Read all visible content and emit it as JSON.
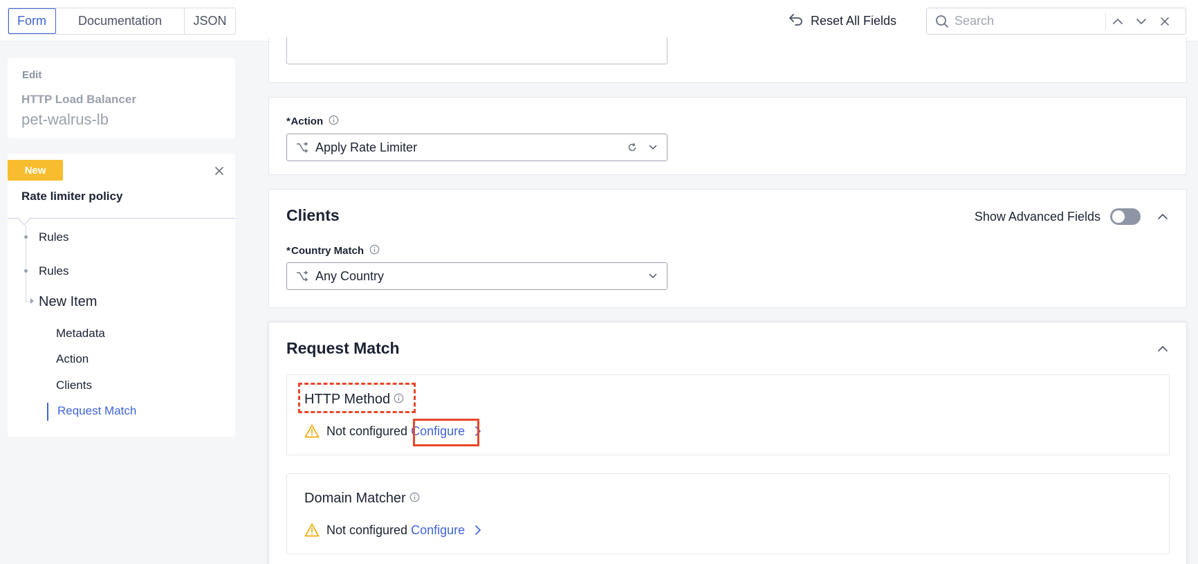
{
  "toolbar": {
    "tabs": [
      "Form",
      "Documentation",
      "JSON"
    ],
    "active_tab": "Form",
    "reset_label": "Reset All Fields",
    "search_placeholder": "Search",
    "search_value": ""
  },
  "sidebar": {
    "edit_label": "Edit",
    "object_kind": "HTTP Load Balancer",
    "object_name": "pet-walrus-lb",
    "badge": "New",
    "nav_title": "Rate limiter policy",
    "tree": [
      {
        "label": "Rules"
      },
      {
        "label": "Rules"
      },
      {
        "label": "New Item"
      }
    ],
    "sections": [
      {
        "label": "Metadata"
      },
      {
        "label": "Action"
      },
      {
        "label": "Clients"
      },
      {
        "label": "Request Match",
        "active": true
      }
    ]
  },
  "main": {
    "action": {
      "label": "Action",
      "required_mark": "*",
      "value": "Apply Rate Limiter"
    },
    "clients": {
      "title": "Clients",
      "advanced_label": "Show Advanced Fields",
      "advanced_on": false,
      "country_label": "Country Match",
      "required_mark": "*",
      "country_value": "Any Country"
    },
    "request_match": {
      "title": "Request Match",
      "items": [
        {
          "title": "HTTP Method",
          "status": "Not configured",
          "action": "Configure"
        },
        {
          "title": "Domain Matcher",
          "status": "Not configured",
          "action": "Configure"
        }
      ]
    }
  },
  "colors": {
    "accent": "#3f64d8",
    "badge": "#f7bd2e",
    "warning": "#f2a900",
    "highlight": "#e8472a"
  }
}
